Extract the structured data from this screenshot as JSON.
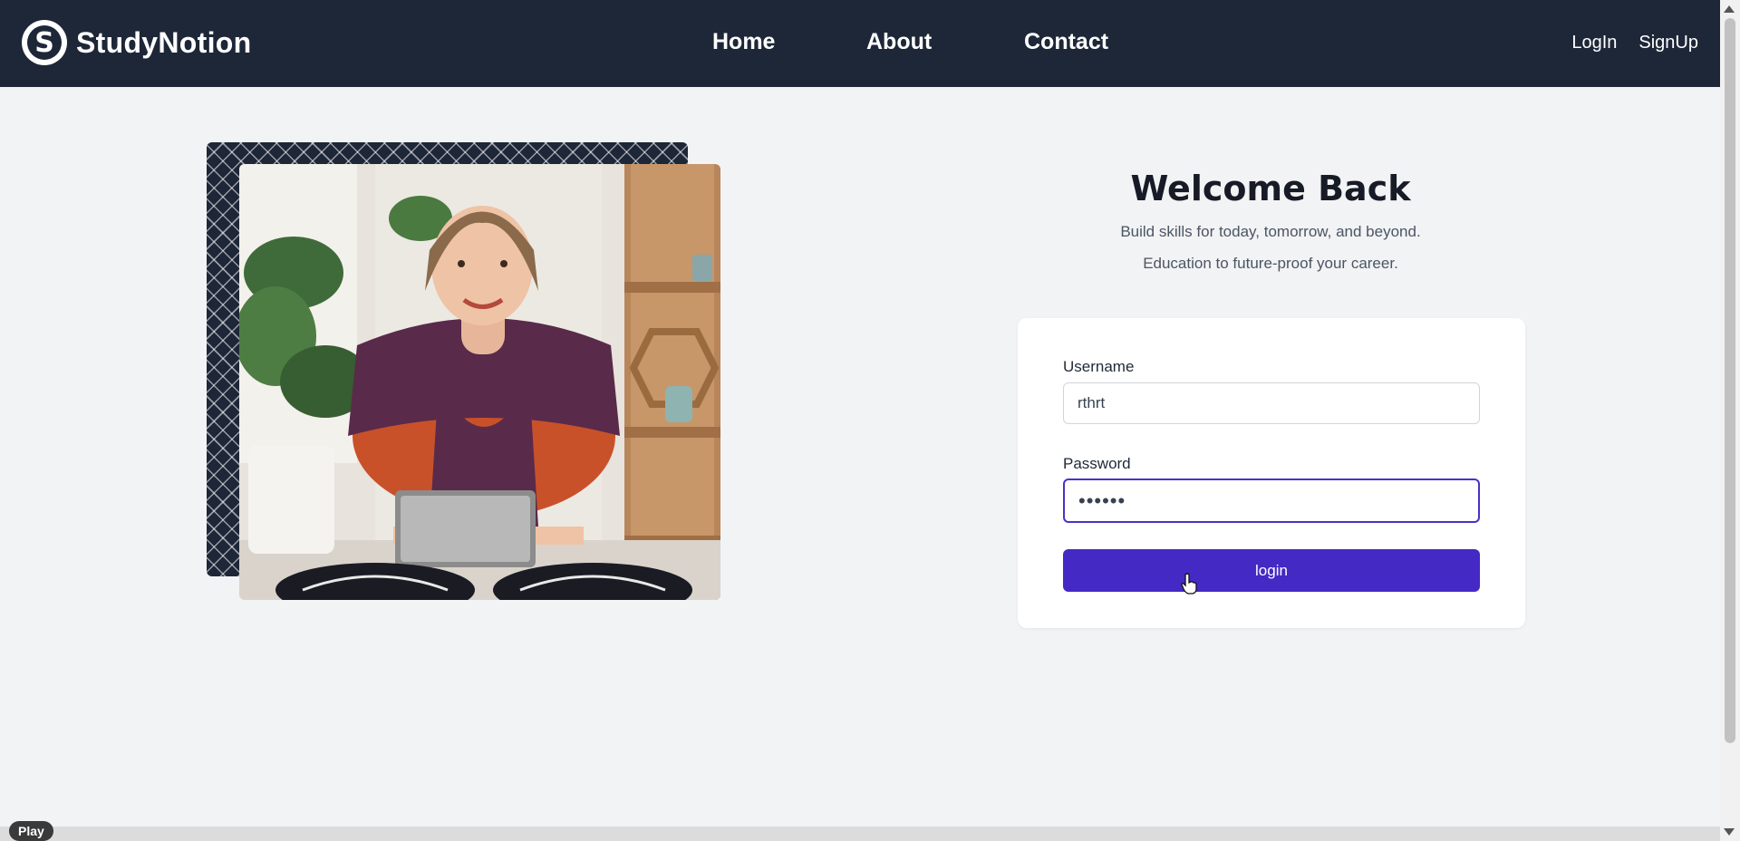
{
  "brand": {
    "logo_letter": "S",
    "name": "StudyNotion"
  },
  "nav": {
    "home": "Home",
    "about": "About",
    "contact": "Contact"
  },
  "auth": {
    "login": "LogIn",
    "signup": "SignUp"
  },
  "hero": {
    "title": "Welcome Back",
    "subtitle_line1": "Build skills for today, tomorrow, and beyond.",
    "subtitle_line2": "Education to future-proof your career."
  },
  "form": {
    "username_label": "Username",
    "username_value": "rthrt",
    "password_label": "Password",
    "password_value": "••••••",
    "submit_label": "login"
  },
  "player": {
    "play_label": "Play"
  },
  "colors": {
    "navbar": "#1e2738",
    "accent": "#4529c5",
    "background": "#f2f3f5"
  }
}
